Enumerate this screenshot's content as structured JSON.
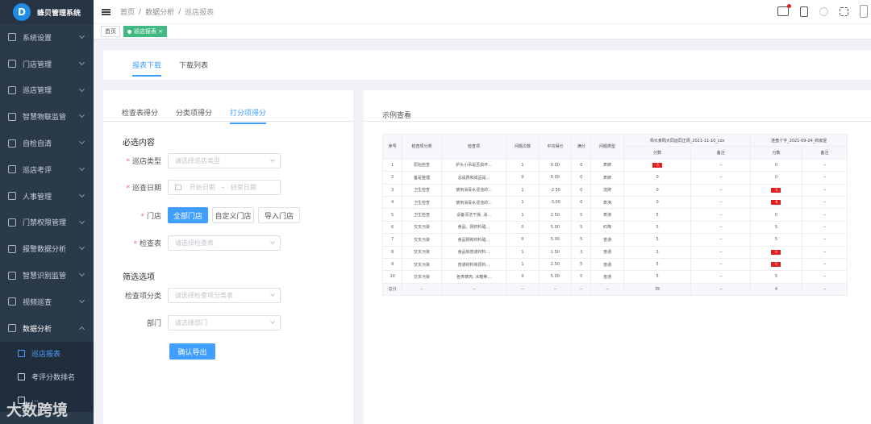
{
  "app": {
    "title": "蜂贝管理系统",
    "logo_letter": "D"
  },
  "sidebar": {
    "items": [
      {
        "label": "系统设置",
        "icon": "user-icon"
      },
      {
        "label": "门店管理",
        "icon": "store-icon"
      },
      {
        "label": "巡店管理",
        "icon": "grid-icon"
      },
      {
        "label": "智慧物联监管",
        "icon": "gear-icon"
      },
      {
        "label": "自检自清",
        "icon": "check-icon"
      },
      {
        "label": "巡店考评",
        "icon": "list-icon"
      },
      {
        "label": "人事管理",
        "icon": "people-icon"
      },
      {
        "label": "门禁权限管理",
        "icon": "door-icon"
      },
      {
        "label": "报警数据分析",
        "icon": "doc-icon"
      },
      {
        "label": "智慧识别监管",
        "icon": "eye-icon"
      },
      {
        "label": "视频巡查",
        "icon": "video-icon"
      },
      {
        "label": "数据分析",
        "icon": "edit-icon"
      }
    ],
    "sub_items": [
      {
        "label": "巡店报表",
        "icon": "report-icon",
        "active": true
      },
      {
        "label": "考评分数排名",
        "icon": "rank-icon",
        "active": false
      },
      {
        "label": "...",
        "icon": "chart-icon",
        "active": false
      }
    ]
  },
  "breadcrumb": [
    "首页",
    "/",
    "数据分析",
    "/",
    "巡店报表"
  ],
  "tags": [
    {
      "label": "首页",
      "active": false
    },
    {
      "label": "巡店报表",
      "close": "×",
      "active": true
    }
  ],
  "top_tabs": [
    {
      "label": "报表下载",
      "active": true
    },
    {
      "label": "下载列表",
      "active": false
    }
  ],
  "left": {
    "tabs": [
      {
        "label": "检查表得分"
      },
      {
        "label": "分类项得分"
      },
      {
        "label": "打分项得分"
      }
    ],
    "section1": "必选内容",
    "section2": "筛选选项",
    "fields": {
      "store_type": {
        "label": "巡店类型",
        "placeholder": "请选择巡店类型"
      },
      "date": {
        "label": "巡查日期",
        "start": "开始日期",
        "sep": "-",
        "end": "结束日期"
      },
      "store": {
        "label": "门店",
        "buttons": [
          "全部门店",
          "自定义门店",
          "导入门店"
        ]
      },
      "checklist": {
        "label": "检查表",
        "placeholder": "请选择检查表"
      },
      "category": {
        "label": "检查项分类",
        "placeholder": "请选择检查项分类表"
      },
      "dept": {
        "label": "部门",
        "placeholder": "请选择部门"
      }
    },
    "export_btn": "确认导出"
  },
  "right": {
    "title": "示例查看",
    "table": {
      "headers": [
        "序号",
        "检查项分类",
        "检查项",
        "问题次数",
        "平均得分",
        "满分",
        "问题类型"
      ],
      "group1": "师大食网大同运同正周_2021-11-10_czx",
      "group2": "连盘十字_2021-09-24_商家屋",
      "sub_headers": [
        "分数",
        "备注",
        "分数",
        "备注"
      ],
      "rows": [
        [
          "1",
          "原始检查",
          "炉头小吊是否损坏...",
          "1",
          "0.00",
          "0",
          "表牌",
          "-5",
          "--",
          "0",
          "--"
        ],
        [
          "2",
          "备是整理",
          "总是费和成品是...",
          "0",
          "0.00",
          "0",
          "表牌",
          "0",
          "--",
          "0",
          "--"
        ],
        [
          "3",
          "卫生检查",
          "使用消毒水浸泡的...",
          "1",
          "-2.50",
          "0",
          "流牌",
          "0",
          "--",
          "-5",
          "--"
        ],
        [
          "4",
          "卫生检查",
          "使用消毒水浸泡的...",
          "1",
          "-3.00",
          "0",
          "表演",
          "0",
          "--",
          "-6",
          "--"
        ],
        [
          "5",
          "卫生检查",
          "设备清洁干燥, 消...",
          "1",
          "2.50",
          "5",
          "表演",
          "5",
          "--",
          "0",
          "--"
        ],
        [
          "6",
          "交叉污染",
          "食品、刚材料碰...",
          "0",
          "5.00",
          "5",
          "红降",
          "5",
          "--",
          "5",
          "--"
        ],
        [
          "7",
          "交叉污染",
          "食品刚和材料碰...",
          "0",
          "5.00",
          "5",
          "普通",
          "5",
          "--",
          "5",
          "--"
        ],
        [
          "8",
          "交叉污染",
          "食品和普通材料...",
          "1",
          "1.50",
          "3",
          "普通",
          "3",
          "--",
          "0",
          "--"
        ],
        [
          "9",
          "交叉污染",
          "普通材料和原料...",
          "1",
          "2.50",
          "5",
          "普通",
          "5",
          "--",
          "0",
          "--"
        ],
        [
          "10",
          "交叉污染",
          "各类菜肉, 冰箱等...",
          "0",
          "5.00",
          "5",
          "普通",
          "5",
          "--",
          "5",
          "--"
        ],
        [
          "总分",
          "--",
          "--",
          "--",
          "--",
          "--",
          "--",
          "35",
          "--",
          "4",
          "--"
        ]
      ],
      "red_cells": [
        [
          0,
          7
        ],
        [
          2,
          9
        ],
        [
          3,
          9
        ],
        [
          7,
          9
        ],
        [
          8,
          9
        ]
      ]
    }
  },
  "watermark": "大数跨境",
  "colors": {
    "sidebar_bg": "#2b3a4b",
    "accent": "#409eff",
    "success": "#42b983",
    "danger": "#e02020"
  }
}
